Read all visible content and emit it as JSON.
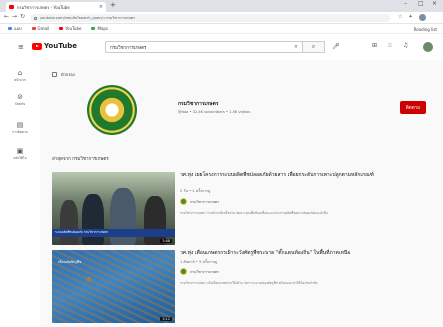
{
  "browser": {
    "tab_title": "กรมวิชาการเกษตร - YouTube",
    "new_tab": "+",
    "url": "youtube.com/results?search_query=กรมวิชาการเกษตร",
    "bookmarks": [
      {
        "label": "แอป",
        "color": "#4285f4"
      },
      {
        "label": "Gmail",
        "color": "#ea4335"
      },
      {
        "label": "YouTube",
        "color": "#ff0000"
      },
      {
        "label": "Maps",
        "color": "#34a853"
      }
    ],
    "reading_list": "Reading list"
  },
  "youtube": {
    "logo_text": "YouTube",
    "search_value": "กรมวิชาการเกษตร",
    "search_clear": "×",
    "search_icon": "search-icon",
    "rail": [
      {
        "icon": "⌂",
        "label": "หน้าแรก"
      },
      {
        "icon": "⊘",
        "label": "Shorts"
      },
      {
        "icon": "▤",
        "label": "การติดตาม"
      },
      {
        "icon": "▣",
        "label": "คลังวิดีโอ"
      }
    ]
  },
  "filter": {
    "label": "ตัวกรอง"
  },
  "channel": {
    "name": "กรมวิชาการเกษตร",
    "meta": "@doa • 32.4K subscribers • 1.5K videos",
    "subscribe_label": "ติดตาม"
  },
  "section": {
    "title": "ล่าสุดจาก กรมวิชาการเกษตร"
  },
  "videos": [
    {
      "title": "วศ.ทุ่ง เผยโครงการระบบผลิตพืชปลอดภัยด้วยสาร เพื่อยกระดับการเพาะปลูกตามหลักเกณฑ์",
      "meta": "2 วัน • 1 ครั้งการดู",
      "channel": "กรมวิชาการเกษตร",
      "desc": "กรมวิชาการเกษตร ร่วมกับภาคีเครือข่าย จัดประชุมเพื่อขับเคลื่อนแนวทางการผลิตพืชอย่างปลอดภัยและยั่งยืน",
      "overlay": "ระบบผลิตพืชปลอดภัย กรมวิชาการเกษตร",
      "duration": "2:48"
    },
    {
      "title": "วศ.ทุ่ง เตือนเกษตรกรเฝ้าระวังศัตรูพืชระบาด \"ตั๊กแตนท้องถิ่น\" ในพื้นที่ภาคเหนือ",
      "meta": "1 สัปดาห์ • 5 ครั้งการดู",
      "channel": "กรมวิชาการเกษตร",
      "desc": "กรมวิชาการเกษตร แจ้งเตือนเกษตรกรให้เฝ้าระวังการระบาดของศัตรูพืช พร้อมแนะนำวิธีป้องกันกำจัด",
      "overlay": "เตือนภัยศัตรูพืช",
      "duration": "3:12"
    }
  ]
}
